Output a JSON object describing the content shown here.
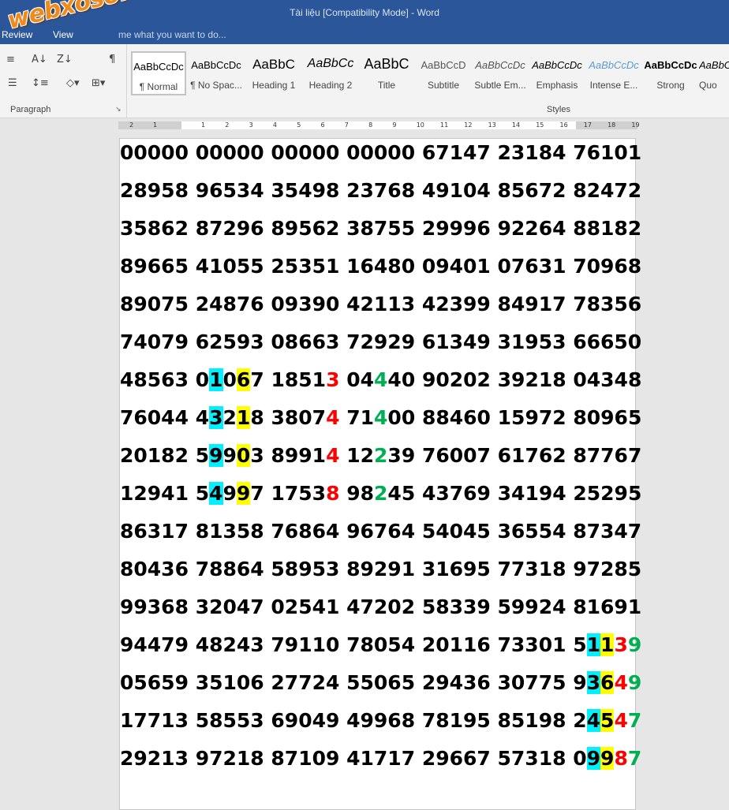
{
  "window": {
    "title": "Tài liệu [Compatibility Mode] - Word"
  },
  "menu": {
    "review": "Review",
    "view": "View",
    "tellme": "me what you want to do..."
  },
  "logo": {
    "text": "webxoso.net"
  },
  "ribbon": {
    "paragraph_label": "Paragraph",
    "styles_label": "Styles",
    "icons": [
      "multilevel-list-icon",
      "sort-icon",
      "pilcrow-icon",
      "align-left-icon",
      "align-justify-icon",
      "line-spacing-icon",
      "shading-icon",
      "borders-icon"
    ],
    "styles": [
      {
        "preview": "AaBbCcDc",
        "name": "¶ Normal"
      },
      {
        "preview": "AaBbCcDc",
        "name": "¶ No Spac..."
      },
      {
        "preview": "AaBbC",
        "name": "Heading 1"
      },
      {
        "preview": "AaBbCc",
        "name": "Heading 2"
      },
      {
        "preview": "AaBbC",
        "name": "Title"
      },
      {
        "preview": "AaBbCcD",
        "name": "Subtitle"
      },
      {
        "preview": "AaBbCcDc",
        "name": "Subtle Em..."
      },
      {
        "preview": "AaBbCcDc",
        "name": "Emphasis"
      },
      {
        "preview": "AaBbCcDc",
        "name": "Intense E..."
      },
      {
        "preview": "AaBbCcDc",
        "name": "Strong"
      },
      {
        "preview": "AaBbCc",
        "name": "Quo"
      }
    ]
  },
  "colors": {
    "cyan": "#00f0ff",
    "yellow": "#ffff00",
    "red": "#ff0000",
    "green": "#00b050",
    "word_blue": "#2b579a"
  },
  "ruler": {
    "ticks": [
      "2",
      "1",
      "1",
      "2",
      "3",
      "4",
      "5",
      "6",
      "7",
      "8",
      "9",
      "10",
      "11",
      "12",
      "13",
      "14",
      "15",
      "16",
      "17",
      "18",
      "19"
    ]
  },
  "document": {
    "rows": [
      [
        "00000",
        "00000",
        "00000",
        "00000",
        "67147",
        "23184",
        "76101"
      ],
      [
        "28958",
        "96534",
        "35498",
        "23768",
        "49104",
        "85672",
        "82472"
      ],
      [
        "35862",
        "87296",
        "89562",
        "38755",
        "29996",
        "92264",
        "88182"
      ],
      [
        "89665",
        "41055",
        "25351",
        "16480",
        "09401",
        "07631",
        "70968"
      ],
      [
        "89075",
        "24876",
        "09390",
        "42113",
        "42399",
        "84917",
        "78356"
      ],
      [
        "74079",
        "62593",
        "08663",
        "72929",
        "61349",
        "31953",
        "66650"
      ],
      [
        "48563",
        "01067",
        "18513",
        "04440",
        "90202",
        "39218",
        "04348"
      ],
      [
        "76044",
        "43218",
        "38074",
        "71400",
        "88460",
        "15972",
        "80965"
      ],
      [
        "20182",
        "59903",
        "89914",
        "12239",
        "76007",
        "61762",
        "87767"
      ],
      [
        "12941",
        "54997",
        "17538",
        "98245",
        "43769",
        "34194",
        "25295"
      ],
      [
        "86317",
        "81358",
        "76864",
        "96764",
        "54045",
        "36554",
        "87347"
      ],
      [
        "80436",
        "78864",
        "58953",
        "89291",
        "31695",
        "77318",
        "97285"
      ],
      [
        "99368",
        "32047",
        "02541",
        "47202",
        "58339",
        "59924",
        "81691"
      ],
      [
        "94479",
        "48243",
        "79110",
        "78054",
        "20116",
        "73301",
        "51139"
      ],
      [
        "05659",
        "35106",
        "27724",
        "55065",
        "29436",
        "30775",
        "93649"
      ],
      [
        "17713",
        "58553",
        "69049",
        "49968",
        "78195",
        "85198",
        "24547"
      ],
      [
        "29213",
        "97218",
        "87109",
        "41717",
        "29667",
        "57318",
        "09987"
      ]
    ],
    "highlights": [
      {
        "row": 6,
        "group": 1,
        "digit": 1,
        "style": "hlc"
      },
      {
        "row": 6,
        "group": 1,
        "digit": 3,
        "style": "hly"
      },
      {
        "row": 6,
        "group": 2,
        "digit": 4,
        "style": "red"
      },
      {
        "row": 6,
        "group": 3,
        "digit": 2,
        "style": "grn"
      },
      {
        "row": 7,
        "group": 1,
        "digit": 1,
        "style": "hlc"
      },
      {
        "row": 7,
        "group": 1,
        "digit": 3,
        "style": "hly"
      },
      {
        "row": 7,
        "group": 2,
        "digit": 4,
        "style": "red"
      },
      {
        "row": 7,
        "group": 3,
        "digit": 2,
        "style": "grn"
      },
      {
        "row": 8,
        "group": 1,
        "digit": 1,
        "style": "hlc"
      },
      {
        "row": 8,
        "group": 1,
        "digit": 3,
        "style": "hly"
      },
      {
        "row": 8,
        "group": 2,
        "digit": 4,
        "style": "red"
      },
      {
        "row": 8,
        "group": 3,
        "digit": 2,
        "style": "grn"
      },
      {
        "row": 9,
        "group": 1,
        "digit": 1,
        "style": "hlc"
      },
      {
        "row": 9,
        "group": 1,
        "digit": 3,
        "style": "hly"
      },
      {
        "row": 9,
        "group": 2,
        "digit": 4,
        "style": "red"
      },
      {
        "row": 9,
        "group": 3,
        "digit": 2,
        "style": "grn"
      },
      {
        "row": 13,
        "group": 6,
        "digit": 1,
        "style": "hlc"
      },
      {
        "row": 13,
        "group": 6,
        "digit": 2,
        "style": "hly"
      },
      {
        "row": 13,
        "group": 6,
        "digit": 3,
        "style": "red"
      },
      {
        "row": 13,
        "group": 6,
        "digit": 4,
        "style": "grn"
      },
      {
        "row": 14,
        "group": 6,
        "digit": 1,
        "style": "hlc"
      },
      {
        "row": 14,
        "group": 6,
        "digit": 2,
        "style": "hly"
      },
      {
        "row": 14,
        "group": 6,
        "digit": 3,
        "style": "red"
      },
      {
        "row": 14,
        "group": 6,
        "digit": 4,
        "style": "grn"
      },
      {
        "row": 15,
        "group": 6,
        "digit": 1,
        "style": "hlc"
      },
      {
        "row": 15,
        "group": 6,
        "digit": 2,
        "style": "hly"
      },
      {
        "row": 15,
        "group": 6,
        "digit": 3,
        "style": "red"
      },
      {
        "row": 15,
        "group": 6,
        "digit": 4,
        "style": "grn"
      },
      {
        "row": 16,
        "group": 6,
        "digit": 1,
        "style": "hlc"
      },
      {
        "row": 16,
        "group": 6,
        "digit": 2,
        "style": "hly"
      },
      {
        "row": 16,
        "group": 6,
        "digit": 3,
        "style": "red"
      },
      {
        "row": 16,
        "group": 6,
        "digit": 4,
        "style": "grn"
      }
    ]
  }
}
